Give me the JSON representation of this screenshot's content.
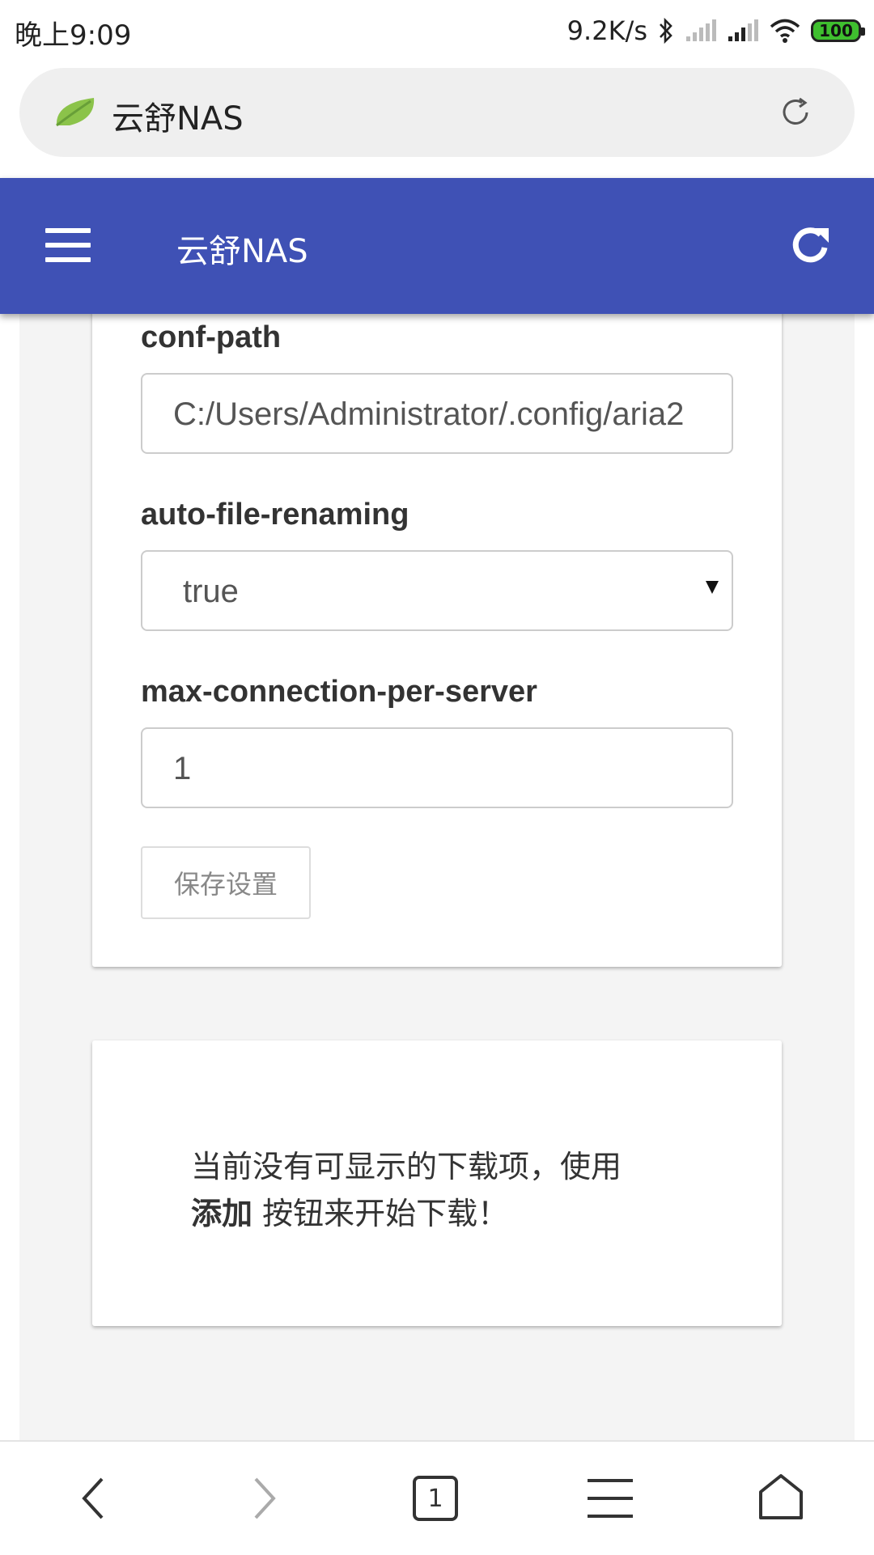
{
  "status_bar": {
    "time": "晚上9:09",
    "net_speed": "9.2K/s",
    "battery": "100",
    "icons": [
      "bluetooth-icon",
      "signal-icon",
      "signal-icon",
      "wifi-icon",
      "battery-icon"
    ]
  },
  "browser": {
    "url_text": "云舒NAS",
    "logo_icon": "leaf-logo",
    "reload_icon": "reload-icon"
  },
  "header": {
    "title": "云舒NAS",
    "menu_icon": "hamburger-menu-icon",
    "refresh_icon": "refresh-icon",
    "color": "#3f51b5"
  },
  "settings": {
    "conf_path": {
      "label": "conf-path",
      "value": "C:/Users/Administrator/.config/aria2"
    },
    "auto_file_renaming": {
      "label": "auto-file-renaming",
      "value": "true"
    },
    "max_connection_per_server": {
      "label": "max-connection-per-server",
      "value": "1"
    },
    "save_label": "保存设置"
  },
  "downloads": {
    "empty_line1": "当前没有可显示的下载项，使用",
    "empty_add": "添加",
    "empty_line2_rest": " 按钮来开始下载！"
  },
  "bottom_nav": {
    "tab_count": "1",
    "icons": [
      "back-icon",
      "forward-icon",
      "tabs-icon",
      "menu-icon",
      "home-icon"
    ]
  }
}
